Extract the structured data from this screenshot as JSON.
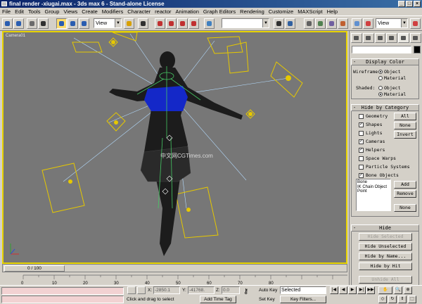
{
  "window": {
    "title": "final render -xiugai.max - 3ds max 6 - Stand-alone License"
  },
  "menu": [
    "File",
    "Edit",
    "Tools",
    "Group",
    "Views",
    "Create",
    "Modifiers",
    "Character",
    "reactor",
    "Animation",
    "Graph Editors",
    "Rendering",
    "Customize",
    "MAXScript",
    "Help"
  ],
  "toolbar": {
    "ref_coord": "View",
    "selection_set": "",
    "view_dropdown": "View"
  },
  "viewport": {
    "label": "Camera01",
    "watermark": "中文网CGTimes.com",
    "active_border_color": "#e8d400",
    "background_color": "#777777"
  },
  "command_panel": {
    "display_color": {
      "title": "Display Color",
      "wireframe_label": "Wireframe:",
      "shaded_label": "Shaded:",
      "options": [
        "Object",
        "Material"
      ],
      "wireframe_selected": "Object",
      "shaded_selected": "Material"
    },
    "hide_by_category": {
      "title": "Hide by Category",
      "categories": [
        {
          "label": "Geometry",
          "checked": false
        },
        {
          "label": "Shapes",
          "checked": true
        },
        {
          "label": "Lights",
          "checked": false
        },
        {
          "label": "Cameras",
          "checked": true
        },
        {
          "label": "Helpers",
          "checked": true
        },
        {
          "label": "Space Warps",
          "checked": false
        },
        {
          "label": "Particle Systems",
          "checked": false
        },
        {
          "label": "Bone Objects",
          "checked": true
        }
      ],
      "buttons": {
        "all": "All",
        "none": "None",
        "invert": "Invert",
        "add": "Add",
        "remove": "Remove",
        "none2": "None"
      },
      "list": [
        "Bone",
        "IK Chain Object",
        "Point"
      ]
    },
    "hide": {
      "title": "Hide",
      "hide_selected": "Hide Selected",
      "hide_unselected": "Hide Unselected",
      "hide_by_name": "Hide by Name...",
      "hide_by_hit": "Hide by Hit",
      "unhide_all": "Unhide All"
    }
  },
  "timeline": {
    "frame": "0 / 100",
    "ticks": [
      "0",
      "10",
      "20",
      "30",
      "40",
      "50",
      "60",
      "70",
      "80"
    ]
  },
  "status": {
    "x_label": "X:",
    "x_value": "-2850.1",
    "y_label": "Y:",
    "y_value": "-41768.",
    "z_label": "Z:",
    "z_value": "0.0",
    "prompt": "Click and drag to select",
    "add_time_tag": "Add Time Tag",
    "auto_key": "Auto Key",
    "selected": "Selected",
    "set_key": "Set Key",
    "key_filters": "Key Filters..."
  },
  "colors": {
    "title_bar": "#0a246a",
    "highlight": "#fcdc6a",
    "scene_yellow": "#e6c800",
    "character_blue": "#1428c8",
    "bone_green": "#46c864",
    "camera_lines": "#b4dcff",
    "prompt_bg": "#f2d2d2"
  }
}
